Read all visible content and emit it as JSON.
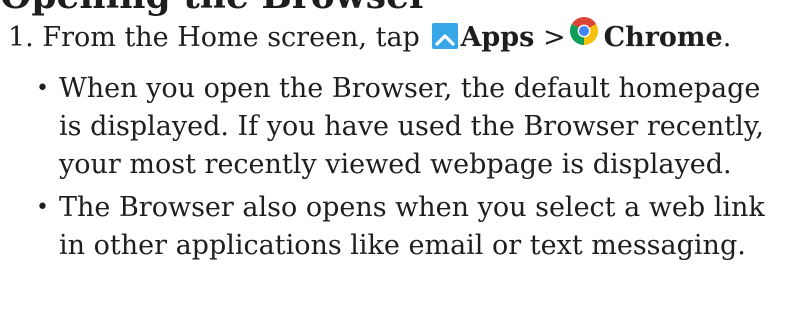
{
  "heading": "Opening the Browser",
  "step": {
    "number": "1.",
    "prefix": "From the Home screen, tap",
    "apps_label": "Apps",
    "separator": ">",
    "chrome_label": "Chrome",
    "suffix": "."
  },
  "bullets": [
    "When you open the Browser, the default homepage is displayed. If you have used the Browser recently, your most recently viewed webpage is displayed.",
    "The Browser also opens when you select a web link in other applications like email or text messaging."
  ],
  "icons": {
    "apps": "apps-icon",
    "chrome": "chrome-icon"
  },
  "colors": {
    "apps_icon": "#38a7e7",
    "chrome_red": "#db4437",
    "chrome_yellow": "#f4c20d",
    "chrome_green": "#0f9d58",
    "chrome_blue": "#4285f4"
  }
}
